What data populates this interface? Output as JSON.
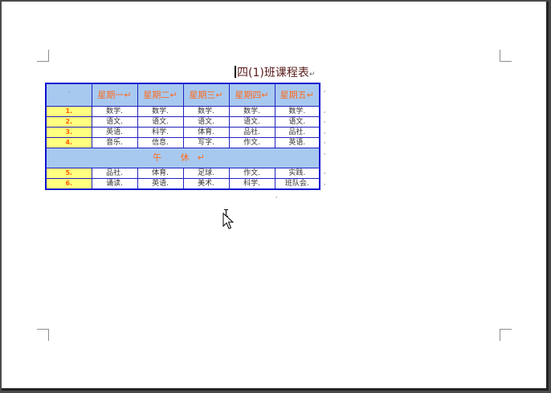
{
  "document": {
    "title": "四(1)班课程表",
    "para_mark": "↵",
    "cell_mark": "¸"
  },
  "table": {
    "corner": "¸",
    "headers": [
      "星期一↵",
      "星期二↵",
      "星期三↵",
      "星期四↵",
      "星期五↵"
    ],
    "morning_rows": [
      {
        "num": "1.",
        "cells": [
          "数学.",
          "数学.",
          "数学.",
          "数学.",
          "数学."
        ]
      },
      {
        "num": "2.",
        "cells": [
          "语文.",
          "语文.",
          "语文.",
          "语文.",
          "语文."
        ]
      },
      {
        "num": "3.",
        "cells": [
          "英语.",
          "科学.",
          "体育.",
          "品社.",
          "品社."
        ]
      },
      {
        "num": "4.",
        "cells": [
          "音乐.",
          "信息.",
          "写字.",
          "作文.",
          "英语."
        ]
      }
    ],
    "lunch_label": "午 休↵",
    "afternoon_rows": [
      {
        "num": "5.",
        "cells": [
          "品社.",
          "体育.",
          "足球.",
          "作文.",
          "实践."
        ]
      },
      {
        "num": "6.",
        "cells": [
          "诵读.",
          "英语.",
          "美术.",
          "科学.",
          "班队会."
        ]
      }
    ]
  },
  "colors": {
    "header_bg": "#a7c9f0",
    "header_text": "#ff6a1a",
    "number_bg": "#ffff80",
    "table_border": "#1010d0"
  }
}
